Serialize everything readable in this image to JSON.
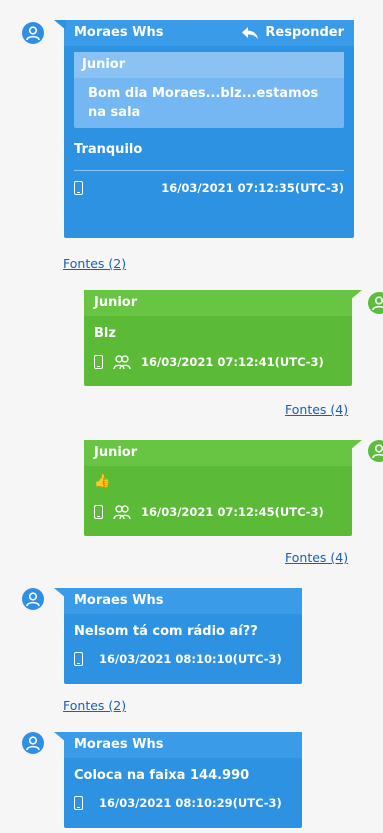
{
  "messages": [
    {
      "sender": "Moraes Whs",
      "reply_label": "Responder",
      "quote": {
        "sender": "Junior",
        "text": "Bom dia  Moraes...blz...estamos na sala"
      },
      "text": "Tranquilo",
      "timestamp": "16/03/2021 07:12:35(UTC-3)",
      "sources": "Fontes (2)"
    },
    {
      "sender": "Junior",
      "text": "Blz",
      "timestamp": "16/03/2021 07:12:41(UTC-3)",
      "sources": "Fontes (4)"
    },
    {
      "sender": "Junior",
      "text": "👍",
      "timestamp": "16/03/2021 07:12:45(UTC-3)",
      "sources": "Fontes (4)"
    },
    {
      "sender": "Moraes Whs",
      "text": "Nelsom tá com rádio aí??",
      "timestamp": "16/03/2021 08:10:10(UTC-3)",
      "sources": "Fontes (2)"
    },
    {
      "sender": "Moraes Whs",
      "text": "Coloca na faixa 144.990",
      "timestamp": "16/03/2021 08:10:29(UTC-3)"
    }
  ],
  "icons": {
    "avatar": "user-avatar-icon",
    "reply": "reply-arrow-icon",
    "phone": "phone-icon",
    "group": "group-icon",
    "thumbs_up": "thumbs-up-icon"
  },
  "colors": {
    "incoming_bubble": "#2e92e3",
    "outgoing_bubble": "#5cbb36",
    "link": "#1a5fb4"
  }
}
